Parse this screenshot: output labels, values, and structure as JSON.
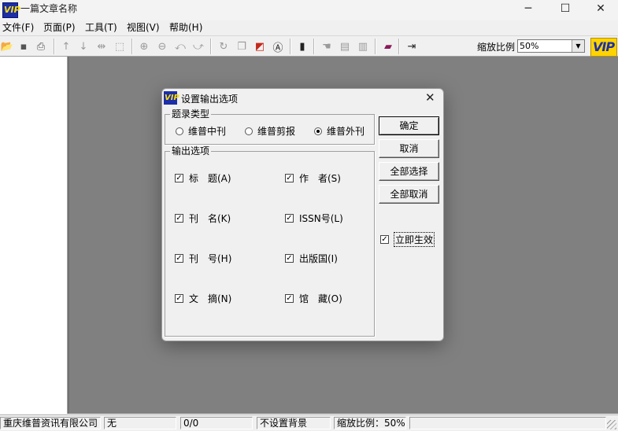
{
  "window": {
    "title": "一篇文章名称",
    "logo_text": "VIP",
    "minimize": "─",
    "maximize": "☐",
    "close": "✕"
  },
  "menu": [
    "文件(F)",
    "页面(P)",
    "工具(T)",
    "视图(V)",
    "帮助(H)"
  ],
  "toolbar": {
    "icons": [
      "open-folder-icon",
      "save-icon",
      "print-icon",
      "arrow-up-icon",
      "arrow-down-icon",
      "fit-width-icon",
      "fit-page-icon",
      "zoom-in-icon",
      "zoom-out-icon",
      "rotate-left-icon",
      "rotate-right-icon",
      "refresh-icon",
      "copy-icon",
      "color-icon",
      "text-icon",
      "bar-chart-icon",
      "hand-icon",
      "page-icon",
      "document-icon",
      "book-icon",
      "exit-icon"
    ],
    "zoom_label": "缩放比例",
    "zoom_value": "50%",
    "brand_logo": "VIP"
  },
  "status": {
    "company": "重庆维普资讯有限公司",
    "field2": "无",
    "page": "0/0",
    "background": "不设置背景",
    "zoom": "缩放比例：50%"
  },
  "dialog": {
    "title": "设置输出选项",
    "close": "✕",
    "record_type": {
      "legend": "题录类型",
      "options": [
        {
          "label": "维普中刊",
          "selected": false
        },
        {
          "label": "维普剪报",
          "selected": false
        },
        {
          "label": "维普外刊",
          "selected": true
        }
      ]
    },
    "output": {
      "legend": "输出选项",
      "items": [
        {
          "label": "标　题(A)",
          "checked": true
        },
        {
          "label": "作　者(S)",
          "checked": true
        },
        {
          "label": "刊　名(K)",
          "checked": true
        },
        {
          "label": "ISSN号(L)",
          "checked": true
        },
        {
          "label": "刊　号(H)",
          "checked": true
        },
        {
          "label": "出版国(I)",
          "checked": true
        },
        {
          "label": "文　摘(N)",
          "checked": true
        },
        {
          "label": "馆　藏(O)",
          "checked": true
        }
      ]
    },
    "buttons": {
      "ok": "确定",
      "cancel": "取消",
      "select_all": "全部选择",
      "deselect_all": "全部取消"
    },
    "apply_now": {
      "label": "立即生效",
      "checked": true
    },
    "check_mark": "✓"
  },
  "colors": {
    "workspace": "#808080",
    "logo_blue": "#1c2fa8",
    "logo_yellow": "#ffd400"
  }
}
